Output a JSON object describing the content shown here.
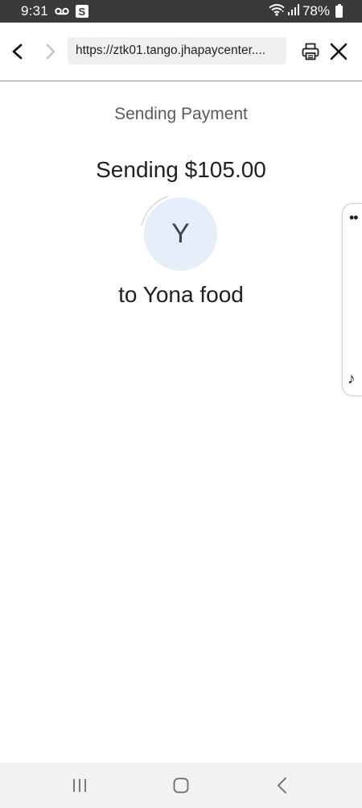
{
  "status_bar": {
    "time": "9:31",
    "notification_icons": [
      "voicemail-icon",
      "s-app-icon"
    ],
    "s_badge": "S",
    "battery": "78%",
    "icons_right": [
      "wifi-icon",
      "signal-icon",
      "battery-icon"
    ]
  },
  "browser": {
    "url": "https://ztk01.tango.jhapaycenter....",
    "icons": [
      "back-arrow-icon",
      "forward-arrow-icon",
      "print-icon",
      "close-icon"
    ]
  },
  "content": {
    "heading": "Sending Payment",
    "amount_line": "Sending $105.00",
    "avatar_letter": "Y",
    "recipient_line": "to Yona food"
  },
  "edge_panel": {
    "dots": "••",
    "note_glyph": "♪"
  },
  "colors": {
    "status_bar_bg": "#3a3a3c",
    "avatar_bg": "#e6eef9",
    "url_box_bg": "#f0f0f0",
    "bottom_nav_bg": "#f2f2f4"
  },
  "system_nav": {
    "icons": [
      "recents-icon",
      "home-icon",
      "back-icon"
    ]
  }
}
